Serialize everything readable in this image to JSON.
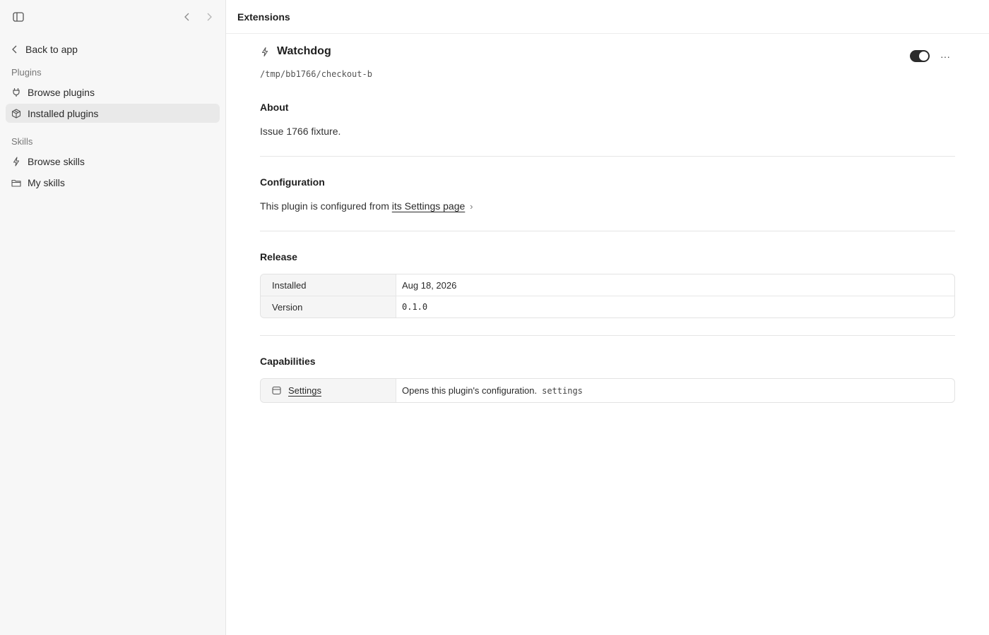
{
  "sidebar": {
    "back_label": "Back to app",
    "plugins_section": "Plugins",
    "plugins_items": [
      {
        "label": "Browse plugins",
        "icon": "plug-icon"
      },
      {
        "label": "Installed plugins",
        "icon": "package-icon",
        "active": true
      }
    ],
    "skills_section": "Skills",
    "skills_items": [
      {
        "label": "Browse skills",
        "icon": "bolt-icon"
      },
      {
        "label": "My skills",
        "icon": "folder-icon"
      }
    ]
  },
  "header": {
    "title": "Extensions"
  },
  "plugin": {
    "name": "Watchdog",
    "path": "/tmp/bb1766/checkout-b",
    "enabled": true,
    "more_label": "···"
  },
  "about": {
    "heading": "About",
    "text": "Issue 1766 fixture."
  },
  "configuration": {
    "heading": "Configuration",
    "prefix": "This plugin is configured from",
    "link": "its Settings page",
    "chevron": "›"
  },
  "release": {
    "heading": "Release",
    "rows": [
      {
        "key": "Installed",
        "value": "Aug 18, 2026"
      },
      {
        "key": "Version",
        "value": "0.1.0"
      }
    ]
  },
  "capabilities": {
    "heading": "Capabilities",
    "rows": [
      {
        "name": "Settings",
        "description": "Opens this plugin's configuration.",
        "code": "settings",
        "icon": "panel-icon"
      }
    ]
  }
}
